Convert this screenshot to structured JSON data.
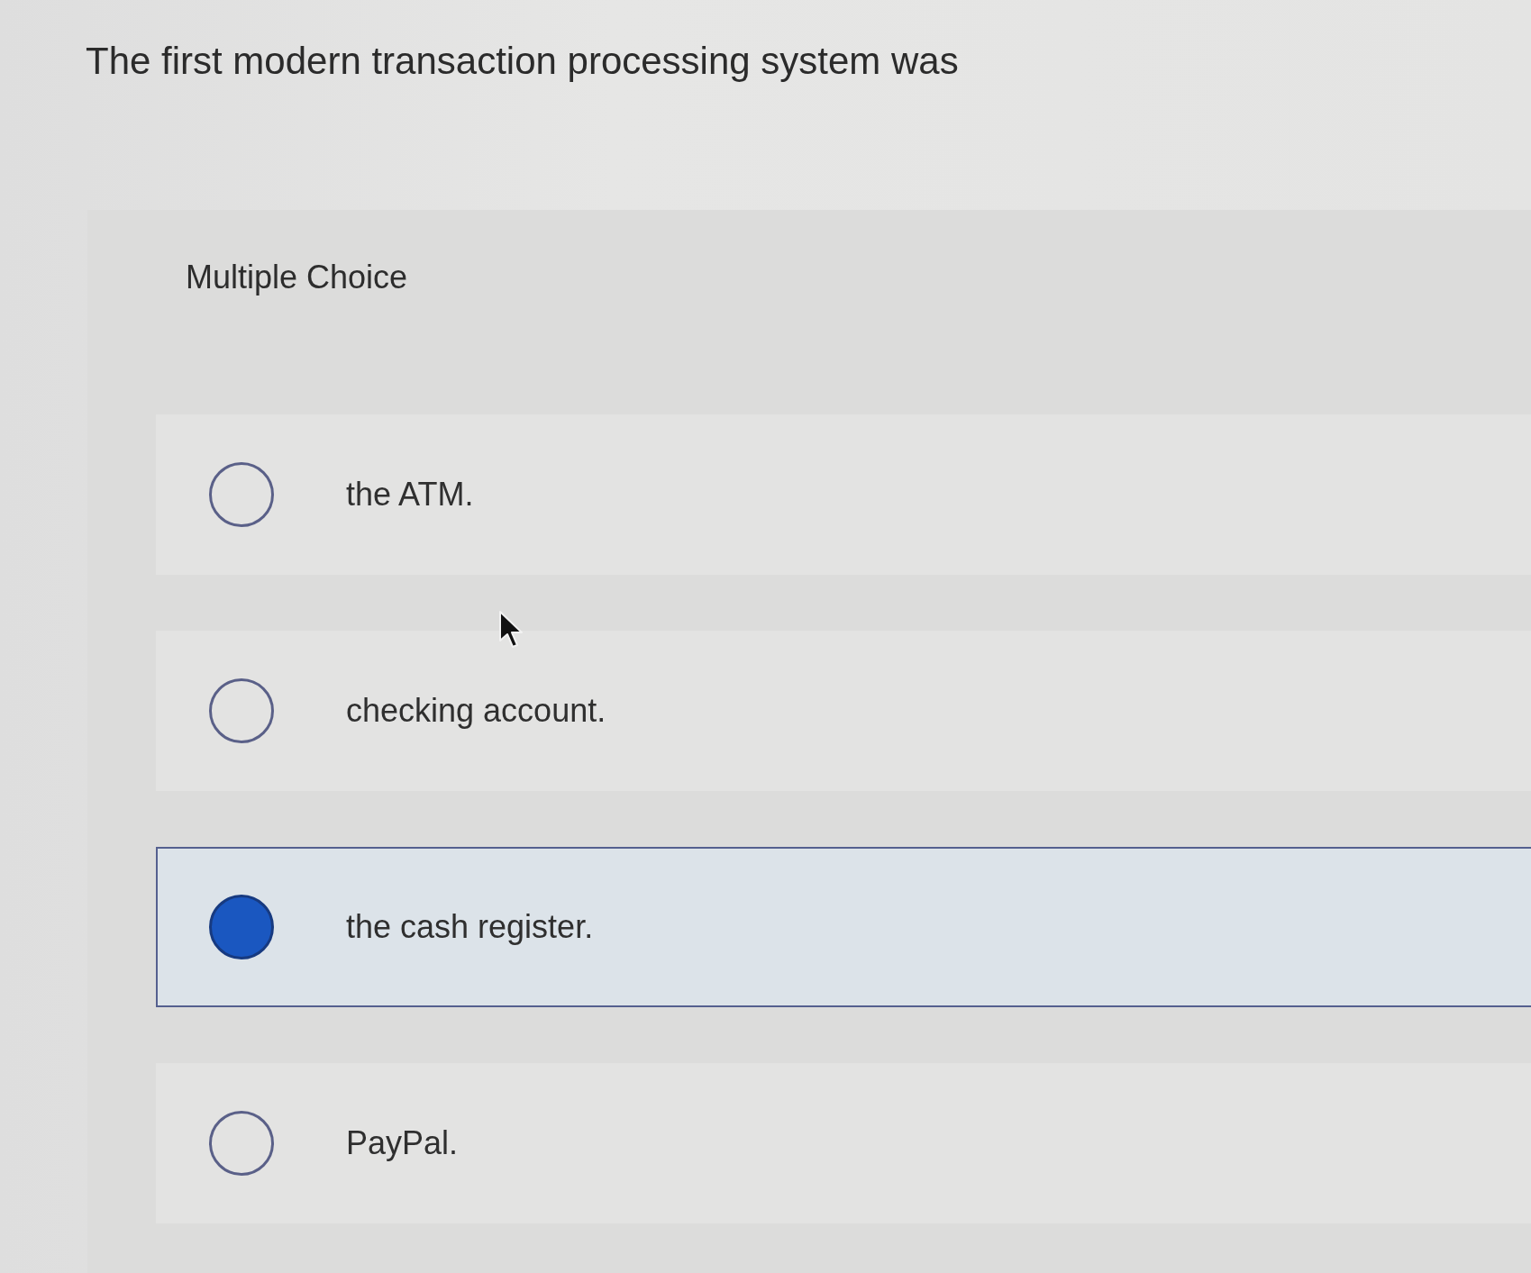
{
  "question": {
    "text": "The first modern transaction processing system was"
  },
  "answer_panel": {
    "heading": "Multiple Choice",
    "options": [
      {
        "label": "the ATM.",
        "selected": false
      },
      {
        "label": "checking account.",
        "selected": false
      },
      {
        "label": "the cash register.",
        "selected": true
      },
      {
        "label": "PayPal.",
        "selected": false
      }
    ]
  }
}
